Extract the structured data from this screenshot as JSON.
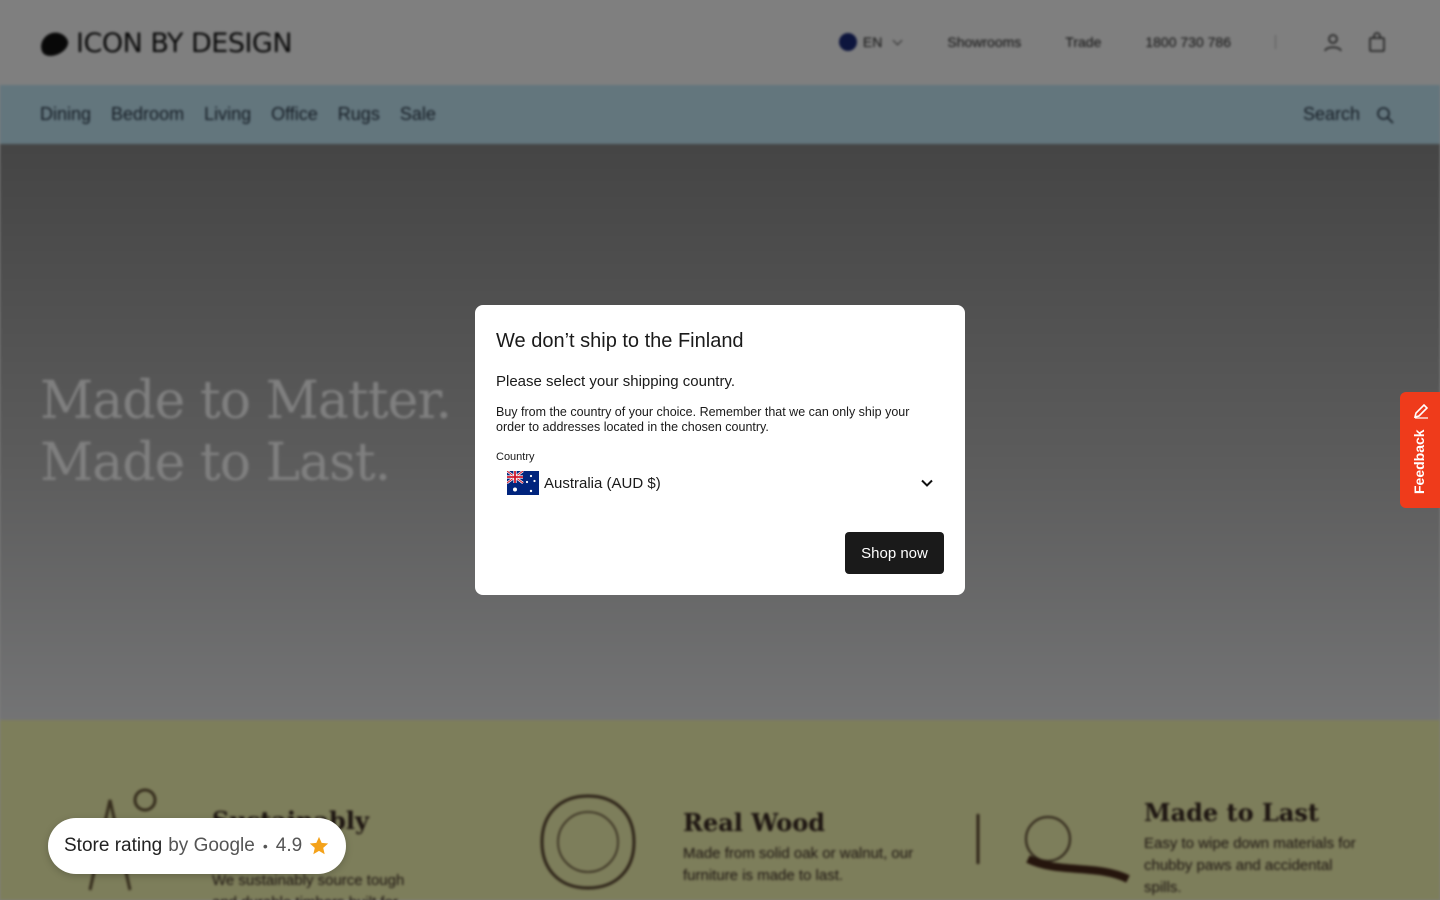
{
  "header": {
    "logo_text": "ICON BY DESIGN",
    "language": "EN",
    "links": [
      "Showrooms",
      "Trade",
      "1800 730 786"
    ]
  },
  "nav": {
    "items": [
      "Dining",
      "Bedroom",
      "Living",
      "Office",
      "Rugs",
      "Sale"
    ],
    "search_label": "Search"
  },
  "hero": {
    "line1": "Made to Matter.",
    "line2": "Made to Last."
  },
  "features": [
    {
      "title": "Sustainably Sourced",
      "text": "We sustainably source tough and durable timbers built for everyday living."
    },
    {
      "title": "Real Wood",
      "text": "Made from solid oak or walnut, our furniture is made to last."
    },
    {
      "title": "Made to Last",
      "text": "Easy to wipe down materials for chubby paws and accidental spills."
    }
  ],
  "modal": {
    "title": "We don’t ship to the Finland",
    "subtitle": "Please select your shipping country.",
    "description": "Buy from the country of your choice. Remember that we can only ship your order to addresses located in the chosen country.",
    "country_label": "Country",
    "country_value": "Australia (AUD $)",
    "button_label": "Shop now"
  },
  "feedback": {
    "label": "Feedback",
    "color": "#ef3b1b"
  },
  "store_rating": {
    "label": "Store rating",
    "by": "by Google",
    "separator": "•",
    "score": "4.9"
  },
  "colors": {
    "nav_bg": "#c6ecfb",
    "features_bg": "#fbfcb6",
    "button_bg": "#1a1a1a",
    "star": "#f4a21a"
  }
}
